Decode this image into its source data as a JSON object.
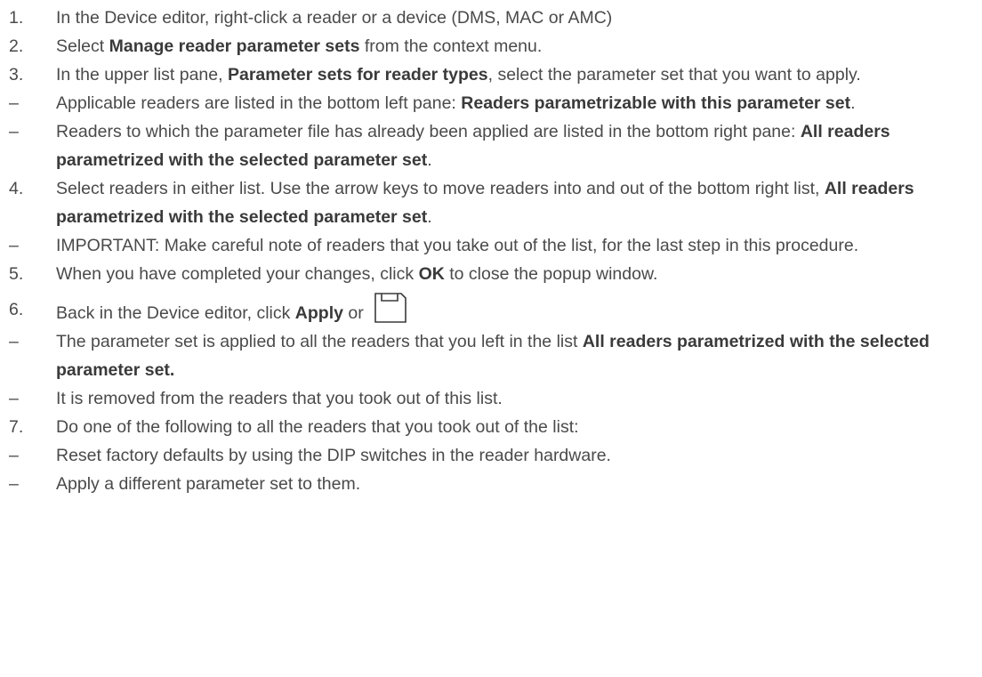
{
  "steps": [
    {
      "marker": "1.",
      "parts": [
        {
          "t": "In the Device editor, right-click a reader or a device (DMS, MAC or AMC)",
          "b": false
        }
      ]
    },
    {
      "marker": "2.",
      "parts": [
        {
          "t": "Select ",
          "b": false
        },
        {
          "t": "Manage reader parameter sets",
          "b": true
        },
        {
          "t": " from the context menu.",
          "b": false
        }
      ]
    },
    {
      "marker": "3.",
      "parts": [
        {
          "t": "In the upper list pane, ",
          "b": false
        },
        {
          "t": "Parameter sets for reader types",
          "b": true
        },
        {
          "t": ", select the parameter set that you want to apply.",
          "b": false
        }
      ]
    },
    {
      "marker": "–",
      "parts": [
        {
          "t": "Applicable readers are listed in the bottom left pane: ",
          "b": false
        },
        {
          "t": "Readers parametrizable with this parameter set",
          "b": true
        },
        {
          "t": ".",
          "b": false
        }
      ]
    },
    {
      "marker": "–",
      "parts": [
        {
          "t": "Readers to which the parameter file has already been applied are listed in the bottom right pane: ",
          "b": false
        },
        {
          "t": "All readers parametrized with the selected parameter set",
          "b": true
        },
        {
          "t": ".",
          "b": false
        }
      ]
    },
    {
      "marker": "4.",
      "parts": [
        {
          "t": "Select readers in either list. Use the arrow keys to move readers into and out of the bottom right list, ",
          "b": false
        },
        {
          "t": "All readers parametrized with the selected parameter set",
          "b": true
        },
        {
          "t": ".",
          "b": false
        }
      ]
    },
    {
      "marker": "–",
      "parts": [
        {
          "t": "IMPORTANT: Make careful note of readers that you take out of the list, for the last step in this procedure.",
          "b": false
        }
      ]
    },
    {
      "marker": "5.",
      "parts": [
        {
          "t": "When you have completed your changes, click ",
          "b": false
        },
        {
          "t": "OK",
          "b": true
        },
        {
          "t": " to close the popup window.",
          "b": false
        }
      ]
    },
    {
      "marker": "6.",
      "icon": "save-icon",
      "parts": [
        {
          "t": "Back in the Device editor, click ",
          "b": false
        },
        {
          "t": "Apply",
          "b": true
        },
        {
          "t": " or ",
          "b": false
        }
      ]
    },
    {
      "marker": "–",
      "parts": [
        {
          "t": "The parameter set is applied to all the readers that you left in the list ",
          "b": false
        },
        {
          "t": "All readers parametrized with the selected parameter set.",
          "b": true
        }
      ]
    },
    {
      "marker": "–",
      "parts": [
        {
          "t": "It is removed from the readers that you took out of this list.",
          "b": false
        }
      ]
    },
    {
      "marker": "7.",
      "parts": [
        {
          "t": "Do one of the following to all the readers that you took out of the list:",
          "b": false
        }
      ]
    },
    {
      "marker": "–",
      "parts": [
        {
          "t": "Reset factory defaults by using the DIP switches in the reader hardware.",
          "b": false
        }
      ]
    },
    {
      "marker": "–",
      "parts": [
        {
          "t": "Apply a different parameter set to them.",
          "b": false
        }
      ]
    }
  ]
}
